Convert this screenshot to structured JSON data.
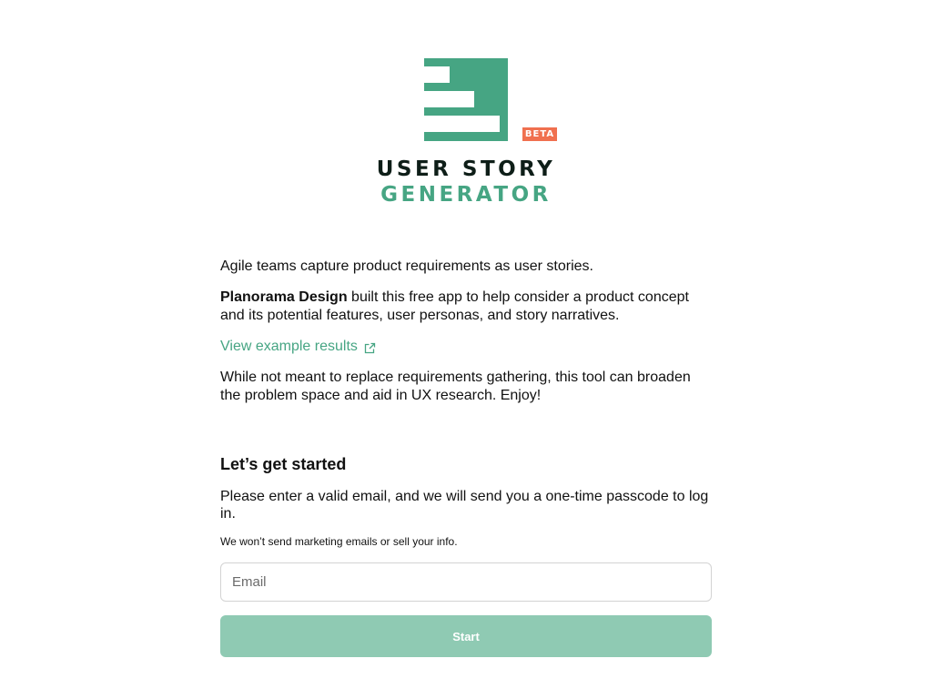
{
  "brand": {
    "logo_line1": "USER STORY",
    "logo_line2": "GENERATOR",
    "badge": "BETA",
    "logo_icon": "bar-chart-logo-icon",
    "colors": {
      "green": "#46a583",
      "badge_orange": "#f0704f",
      "dark": "#0e1e18",
      "button_disabled": "#8fcab3"
    }
  },
  "intro": {
    "line1": "Agile teams capture product requirements as user stories.",
    "company": "Planorama Design",
    "line2_rest": " built this free app to help consider a product concept and its potential features, user personas, and story narratives.",
    "example_link": "View example results",
    "example_link_icon": "external-link-icon",
    "line3": "While not meant to replace requirements gathering, this tool can broaden the problem space and aid in UX research. Enjoy!"
  },
  "signup": {
    "title": "Let’s get started",
    "instructions": "Please enter a valid email, and we will send you a one-time passcode to log in.",
    "privacy_note": "We won’t send marketing emails or sell your info.",
    "email_placeholder": "Email",
    "email_value": "",
    "start_label": "Start"
  }
}
